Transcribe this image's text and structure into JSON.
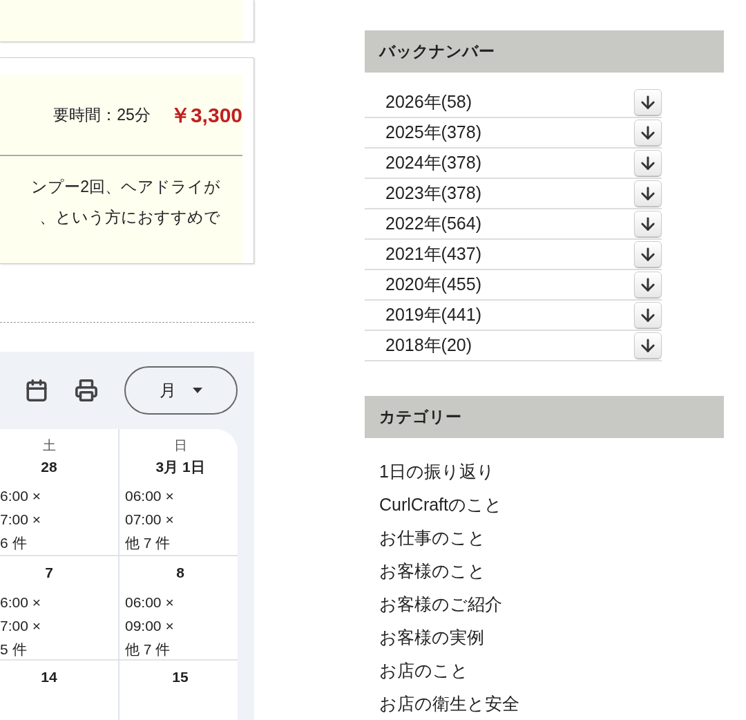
{
  "menu_card": {
    "duration": "要時間：25分",
    "price": "￥3,300",
    "description_lines": [
      "ンプー2回、ヘアドライが",
      "、という方におすすめで"
    ]
  },
  "calendar": {
    "view_select": "月",
    "columns": [
      {
        "weekday": "土",
        "weeks": [
          {
            "date": "28",
            "events": [
              "6:00 ×",
              "7:00 ×"
            ],
            "more": "6 件"
          },
          {
            "date": "7",
            "events": [
              "6:00 ×",
              "7:00 ×"
            ],
            "more": "5 件"
          },
          {
            "date": "14"
          }
        ]
      },
      {
        "weekday": "日",
        "weeks": [
          {
            "date": "3月 1日",
            "events": [
              "06:00 ×",
              "07:00 ×"
            ],
            "more": "他 7 件"
          },
          {
            "date": "8",
            "events": [
              "06:00 ×",
              "09:00 ×"
            ],
            "more": "他 7 件"
          },
          {
            "date": "15"
          }
        ]
      }
    ]
  },
  "back_numbers": {
    "title": "バックナンバー",
    "items": [
      {
        "label": "2026年(58)"
      },
      {
        "label": "2025年(378)"
      },
      {
        "label": "2024年(378)"
      },
      {
        "label": "2023年(378)"
      },
      {
        "label": "2022年(564)"
      },
      {
        "label": "2021年(437)"
      },
      {
        "label": "2020年(455)"
      },
      {
        "label": "2019年(441)"
      },
      {
        "label": "2018年(20)"
      }
    ]
  },
  "categories": {
    "title": "カテゴリー",
    "items": [
      "1日の振り返り",
      "CurlCraftのこと",
      "お仕事のこと",
      "お客様のこと",
      "お客様のご紹介",
      "お客様の実例",
      "お店のこと",
      "お店の衛生と安全"
    ]
  }
}
